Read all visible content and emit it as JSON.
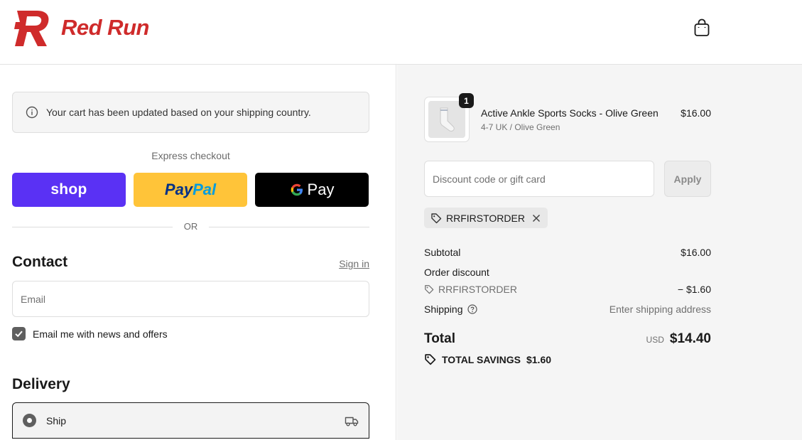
{
  "brand": {
    "name": "Red Run",
    "color": "#cf2b2b"
  },
  "header": {
    "cart_icon": "shopping-bag-icon"
  },
  "notice": {
    "text": "Your cart has been updated based on your shipping country.",
    "icon": "info-icon"
  },
  "express": {
    "label": "Express checkout",
    "shop_label": "shop",
    "paypal_part1": "Pay",
    "paypal_part2": "Pal",
    "gpay_g": "G",
    "gpay_text": "Pay",
    "or_text": "OR"
  },
  "contact": {
    "title": "Contact",
    "sign_in": "Sign in",
    "email_placeholder": "Email",
    "newsletter_label": "Email me with news and offers",
    "newsletter_checked": true
  },
  "delivery": {
    "title": "Delivery",
    "option_label": "Ship",
    "option_icon": "truck-icon"
  },
  "cart": {
    "item": {
      "name": "Active Ankle Sports Socks - Olive Green",
      "variant": "4-7 UK / Olive Green",
      "price": "$16.00",
      "quantity": "1"
    },
    "discount_placeholder": "Discount code or gift card",
    "apply_label": "Apply",
    "applied_code": "RRFIRSTORDER"
  },
  "summary": {
    "subtotal_label": "Subtotal",
    "subtotal_value": "$16.00",
    "order_discount_label": "Order discount",
    "discount_code": "RRFIRSTORDER",
    "discount_value": "− $1.60",
    "shipping_label": "Shipping",
    "shipping_value": "Enter shipping address",
    "total_label": "Total",
    "currency": "USD",
    "total_value": "$14.40",
    "savings_label": "TOTAL SAVINGS",
    "savings_value": "$1.60"
  },
  "colors": {
    "shop": "#5a31f4",
    "paypal": "#ffc439",
    "gpay": "#000000"
  }
}
